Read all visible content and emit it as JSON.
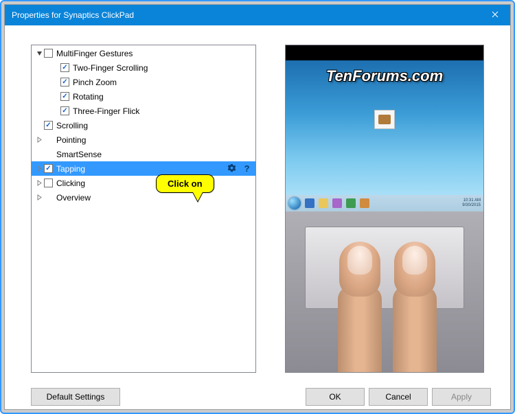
{
  "window": {
    "title": "Properties for Synaptics ClickPad"
  },
  "tree": {
    "items": [
      {
        "label": "MultiFinger Gestures",
        "level": 0,
        "arrow": "down",
        "checkbox": "unchecked",
        "selected": false
      },
      {
        "label": "Two-Finger Scrolling",
        "level": 1,
        "arrow": null,
        "checkbox": "checked",
        "selected": false
      },
      {
        "label": "Pinch Zoom",
        "level": 1,
        "arrow": null,
        "checkbox": "checked",
        "selected": false
      },
      {
        "label": "Rotating",
        "level": 1,
        "arrow": null,
        "checkbox": "checked",
        "selected": false
      },
      {
        "label": "Three-Finger Flick",
        "level": 1,
        "arrow": null,
        "checkbox": "checked",
        "selected": false
      },
      {
        "label": "Scrolling",
        "level": 0,
        "arrow": "spacer",
        "checkbox": "checked",
        "selected": false
      },
      {
        "label": "Pointing",
        "level": 0,
        "arrow": "right",
        "checkbox": "spacer",
        "selected": false
      },
      {
        "label": "SmartSense",
        "level": 0,
        "arrow": "spacer",
        "checkbox": "spacer",
        "selected": false
      },
      {
        "label": "Tapping",
        "level": 0,
        "arrow": "right",
        "checkbox": "checked",
        "selected": true,
        "gear": true,
        "help": true
      },
      {
        "label": "Clicking",
        "level": 0,
        "arrow": "right",
        "checkbox": "unchecked",
        "selected": false
      },
      {
        "label": "Overview",
        "level": 0,
        "arrow": "right",
        "checkbox": "spacer",
        "selected": false
      }
    ]
  },
  "callout": {
    "text": "Click on"
  },
  "preview": {
    "watermark": "TenForums.com"
  },
  "buttons": {
    "default_settings": "Default Settings",
    "ok": "OK",
    "cancel": "Cancel",
    "apply": "Apply"
  }
}
